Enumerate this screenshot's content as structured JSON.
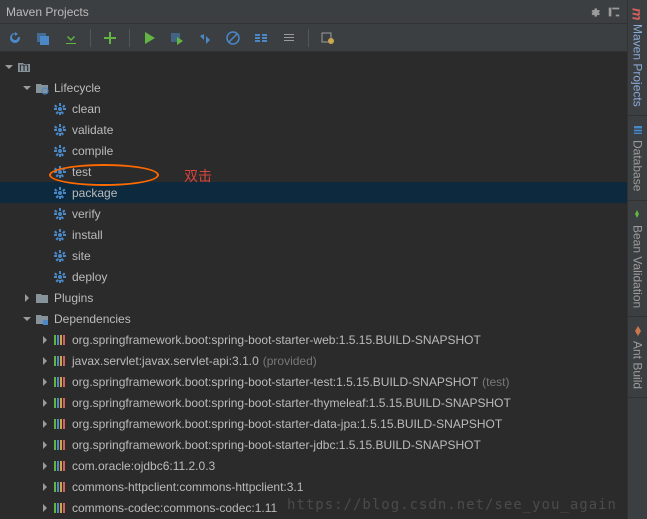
{
  "header": {
    "title": "Maven Projects"
  },
  "sideTabs": [
    {
      "label": "Maven Projects",
      "active": true
    },
    {
      "label": "Database"
    },
    {
      "label": "Bean Validation"
    },
    {
      "label": "Ant Build"
    }
  ],
  "rootProject": {
    "label": ""
  },
  "lifecycle": {
    "label": "Lifecycle",
    "goals": [
      "clean",
      "validate",
      "compile",
      "test",
      "package",
      "verify",
      "install",
      "site",
      "deploy"
    ],
    "selected": "package"
  },
  "plugins": {
    "label": "Plugins"
  },
  "dependencies": {
    "label": "Dependencies",
    "items": [
      {
        "label": "org.springframework.boot:spring-boot-starter-web:1.5.15.BUILD-SNAPSHOT",
        "hint": ""
      },
      {
        "label": "javax.servlet:javax.servlet-api:3.1.0",
        "hint": "(provided)"
      },
      {
        "label": "org.springframework.boot:spring-boot-starter-test:1.5.15.BUILD-SNAPSHOT",
        "hint": "(test)"
      },
      {
        "label": "org.springframework.boot:spring-boot-starter-thymeleaf:1.5.15.BUILD-SNAPSHOT",
        "hint": ""
      },
      {
        "label": "org.springframework.boot:spring-boot-starter-data-jpa:1.5.15.BUILD-SNAPSHOT",
        "hint": ""
      },
      {
        "label": "org.springframework.boot:spring-boot-starter-jdbc:1.5.15.BUILD-SNAPSHOT",
        "hint": ""
      },
      {
        "label": "com.oracle:ojdbc6:11.2.0.3",
        "hint": ""
      },
      {
        "label": "commons-httpclient:commons-httpclient:3.1",
        "hint": ""
      },
      {
        "label": "commons-codec:commons-codec:1.11",
        "hint": ""
      }
    ]
  },
  "annotation": {
    "text": "双击"
  },
  "watermark": "https://blog.csdn.net/see_you_again"
}
